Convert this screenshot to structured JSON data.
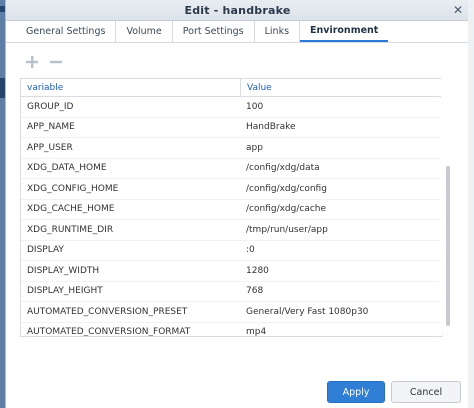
{
  "dialog": {
    "title": "Edit - handbrake"
  },
  "tabs": [
    {
      "label": "General Settings",
      "active": false
    },
    {
      "label": "Volume",
      "active": false
    },
    {
      "label": "Port Settings",
      "active": false
    },
    {
      "label": "Links",
      "active": false
    },
    {
      "label": "Environment",
      "active": true
    }
  ],
  "toolbar": {
    "add_icon": "plus-icon",
    "remove_icon": "minus-icon"
  },
  "table": {
    "columns": [
      "variable",
      "Value"
    ],
    "rows": [
      {
        "variable": "GROUP_ID",
        "value": "100"
      },
      {
        "variable": "APP_NAME",
        "value": "HandBrake"
      },
      {
        "variable": "APP_USER",
        "value": "app"
      },
      {
        "variable": "XDG_DATA_HOME",
        "value": "/config/xdg/data"
      },
      {
        "variable": "XDG_CONFIG_HOME",
        "value": "/config/xdg/config"
      },
      {
        "variable": "XDG_CACHE_HOME",
        "value": "/config/xdg/cache"
      },
      {
        "variable": "XDG_RUNTIME_DIR",
        "value": "/tmp/run/user/app"
      },
      {
        "variable": "DISPLAY",
        "value": ":0"
      },
      {
        "variable": "DISPLAY_WIDTH",
        "value": "1280"
      },
      {
        "variable": "DISPLAY_HEIGHT",
        "value": "768"
      },
      {
        "variable": "AUTOMATED_CONVERSION_PRESET",
        "value": "General/Very Fast 1080p30"
      },
      {
        "variable": "AUTOMATED_CONVERSION_FORMAT",
        "value": "mp4"
      }
    ]
  },
  "footer": {
    "apply_label": "Apply",
    "cancel_label": "Cancel"
  },
  "colors": {
    "accent": "#2f7fd6",
    "header_text": "#1f5fbf"
  }
}
